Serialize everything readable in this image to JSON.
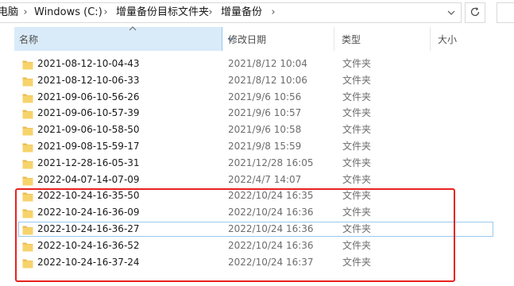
{
  "address_bar": {
    "crumbs": [
      "电脑",
      "Windows (C:)",
      "增量备份目标文件夹",
      "增量备份"
    ],
    "separator": "›",
    "dropdown_icon": "chevron-down-icon",
    "refresh_icon": "refresh-icon"
  },
  "columns": {
    "name": "名称",
    "date": "修改日期",
    "type": "类型",
    "size": "大小",
    "sorted_by": "name",
    "sort_direction": "ascending"
  },
  "files": [
    {
      "name": "2021-08-12-10-04-43",
      "date": "2021/8/12 10:04",
      "type": "文件夹"
    },
    {
      "name": "2021-08-12-10-06-33",
      "date": "2021/8/12 10:06",
      "type": "文件夹"
    },
    {
      "name": "2021-09-06-10-56-26",
      "date": "2021/9/6 10:56",
      "type": "文件夹"
    },
    {
      "name": "2021-09-06-10-57-39",
      "date": "2021/9/6 10:57",
      "type": "文件夹"
    },
    {
      "name": "2021-09-06-10-58-50",
      "date": "2021/9/6 10:58",
      "type": "文件夹"
    },
    {
      "name": "2021-09-08-15-59-17",
      "date": "2021/9/8 15:59",
      "type": "文件夹"
    },
    {
      "name": "2021-12-28-16-05-31",
      "date": "2021/12/28 16:05",
      "type": "文件夹"
    },
    {
      "name": "2022-04-07-14-07-09",
      "date": "2022/4/7 14:07",
      "type": "文件夹"
    },
    {
      "name": "2022-10-24-16-35-50",
      "date": "2022/10/24 16:35",
      "type": "文件夹"
    },
    {
      "name": "2022-10-24-16-36-09",
      "date": "2022/10/24 16:36",
      "type": "文件夹"
    },
    {
      "name": "2022-10-24-16-36-27",
      "date": "2022/10/24 16:36",
      "type": "文件夹"
    },
    {
      "name": "2022-10-24-16-36-52",
      "date": "2022/10/24 16:36",
      "type": "文件夹"
    },
    {
      "name": "2022-10-24-16-37-24",
      "date": "2022/10/24 16:37",
      "type": "文件夹"
    }
  ],
  "hovered_row": 10,
  "colors": {
    "folder": "#f6d36b",
    "folder_tab": "#e8b84a",
    "highlight_box": "#e8231f",
    "header_active_bg": "#d9ebf9"
  }
}
